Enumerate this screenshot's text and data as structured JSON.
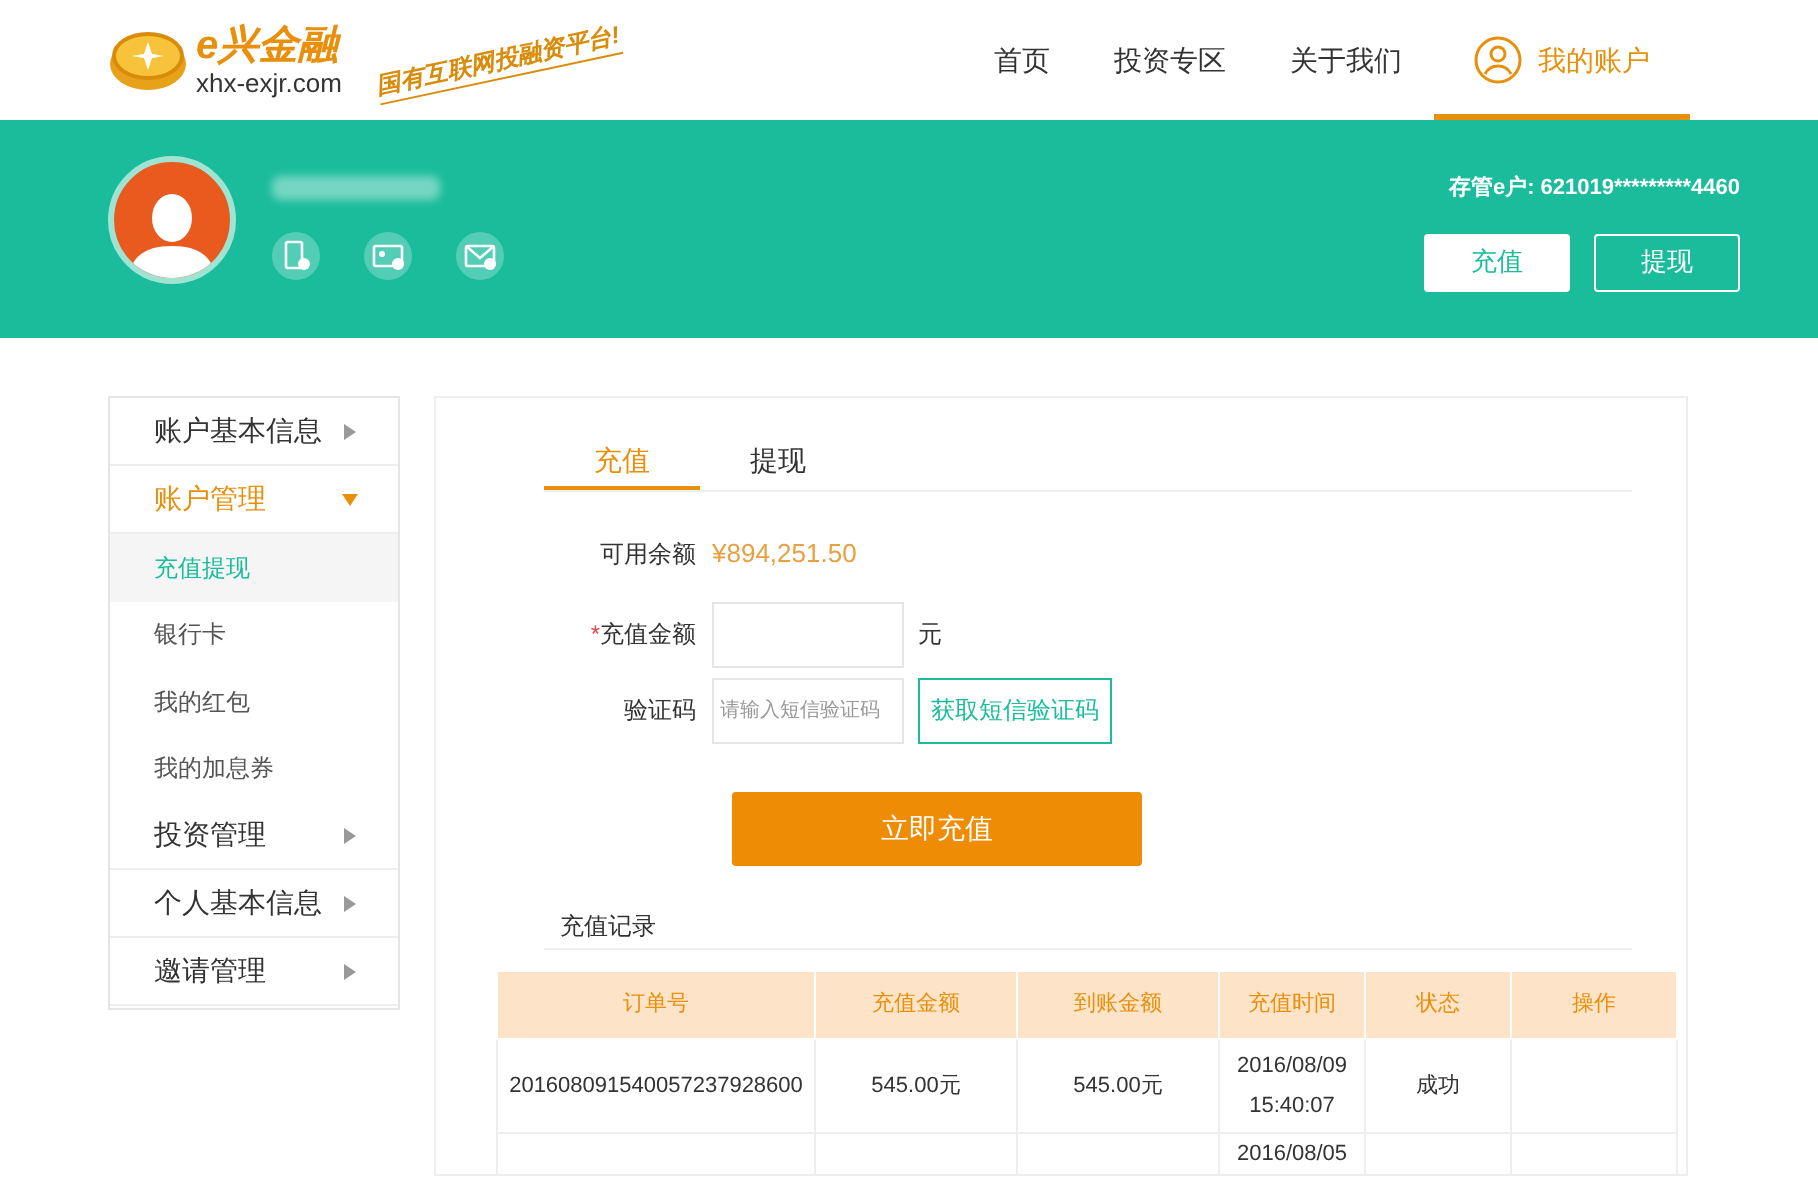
{
  "logo": {
    "brand": "e兴金融",
    "domain": "xhx-exjr.com",
    "slogan": "国有互联网投融资平台!"
  },
  "nav": [
    {
      "label": "首页",
      "selected": false
    },
    {
      "label": "投资专区",
      "selected": false
    },
    {
      "label": "关于我们",
      "selected": false
    },
    {
      "label": "我的账户",
      "selected": true,
      "kind": "account"
    }
  ],
  "profile": {
    "account_label": "存管e户: 621019*********4460",
    "buttons": [
      {
        "label": "充值",
        "kind": "primary"
      },
      {
        "label": "提现",
        "kind": "outline"
      }
    ]
  },
  "sidebar": [
    {
      "label": "账户基本信息",
      "expanded": false
    },
    {
      "label": "账户管理",
      "expanded": true,
      "children": [
        {
          "label": "充值提现",
          "selected": true
        },
        {
          "label": "银行卡",
          "selected": false
        },
        {
          "label": "我的红包",
          "selected": false
        },
        {
          "label": "我的加息券",
          "selected": false
        }
      ]
    },
    {
      "label": "投资管理",
      "expanded": false
    },
    {
      "label": "个人基本信息",
      "expanded": false
    },
    {
      "label": "邀请管理",
      "expanded": false
    }
  ],
  "tabs": [
    {
      "label": "充值",
      "selected": true
    },
    {
      "label": "提现",
      "selected": false
    }
  ],
  "form": {
    "balance_label": "可用余额",
    "balance": "¥894,251.50",
    "amount_label": "充值金额",
    "required_mark": "*",
    "unit": "元",
    "code_label": "验证码",
    "code_placeholder": "请输入短信验证码",
    "code_button": "获取短信验证码",
    "submit": "立即充值"
  },
  "records": {
    "title": "充值记录",
    "columns": [
      "订单号",
      "充值金额",
      "到账金额",
      "充值时间",
      "状态",
      "操作"
    ],
    "rows": [
      [
        "201608091540057237928600",
        "545.00元",
        "545.00元",
        "2016/08/09 15:40:07",
        "成功",
        ""
      ],
      [
        "",
        "",
        "",
        "2016/08/05",
        "",
        ""
      ]
    ]
  }
}
